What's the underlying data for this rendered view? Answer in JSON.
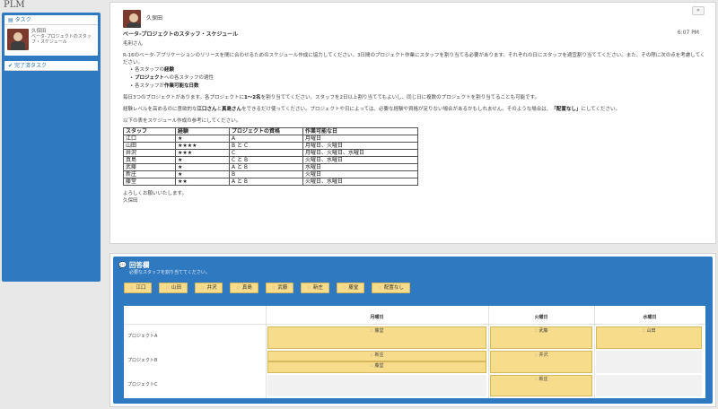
{
  "app": {
    "title": "PLM"
  },
  "sidebar": {
    "tasks_header": "タスク",
    "task": {
      "sender": "久保田",
      "subject": "ベータ-プロジェクトのスタッフ・スケジュール"
    },
    "done_header": "完了済タスク"
  },
  "message": {
    "sender": "久保田",
    "close_label": "«",
    "subject": "ベータ-プロジェクトのスタッフ・スケジュール",
    "time": "6:07 PM",
    "greeting": "毛利さん",
    "para1": "R-16のベータ-アプリケーションのリリースを間に合わせるためのスケジュール作成に協力してください。3日間のプロジェクト作業にスタッフを割り当てる必要があります。それぞれの日にスタッフを適宜割り当ててください。また、その際に次の点を考慮してください。",
    "bullets": [
      {
        "prefix": "各スタッフの",
        "bold": "経験"
      },
      {
        "prefix": "",
        "bold": "プロジェクト",
        "suffix": "への各スタッフの適性"
      },
      {
        "prefix": "各スタッフが",
        "bold": "作業可能な日数"
      }
    ],
    "para2_pre": "毎日3つのプロジェクトがあります。各プロジェクトに",
    "para2_bold": "1～2名",
    "para2_post": "を割り当ててください。スタッフを2日以上割り当ててもよいし、同じ日に複数のプロジェクトを割り当てることも可能です。",
    "para3_pre": "経験レベルを高めるのに意欲的な",
    "para3_bold1": "江口さん",
    "para3_mid": "と",
    "para3_bold2": "真島さん",
    "para3_post": "をできるだけ使ってください。プロジェクトや日によっては、必要な経験や資格が足りない場合があるかもしれません。そのような場合は、",
    "para3_bold3": "「配置なし」",
    "para3_end": "にしてください。",
    "para4": "以下の表をスケジュール作成の参考にしてください。",
    "table": {
      "headers": [
        "スタッフ",
        "経験",
        "プロジェクトの資格",
        "作業可能な日"
      ],
      "rows": [
        [
          "江口",
          "★",
          "A",
          "月曜日"
        ],
        [
          "山田",
          "★★★★",
          "B と C",
          "月曜日、火曜日"
        ],
        [
          "井沢",
          "★★★",
          "C",
          "月曜日、火曜日、水曜日"
        ],
        [
          "真島",
          "★",
          "C と B",
          "火曜日、水曜日"
        ],
        [
          "武藤",
          "★",
          "A と B",
          "水曜日"
        ],
        [
          "新庄",
          "★",
          "B",
          "火曜日"
        ],
        [
          "藤堂",
          "★★",
          "A と B",
          "火曜日、水曜日"
        ]
      ]
    },
    "closing": "よろしくお願いいたします。",
    "signature": "久保田"
  },
  "answer": {
    "title": "回答欄",
    "subtitle": "必要なスタッフを割り当ててください。",
    "chips": [
      "江口",
      "山田",
      "井沢",
      "真島",
      "武藤",
      "新庄",
      "藤堂",
      "配置なし"
    ],
    "grip": "::",
    "days": [
      "月曜日",
      "火曜日",
      "水曜日"
    ],
    "projects": [
      "プロジェクトA",
      "プロジェクトB",
      "プロジェクトC"
    ],
    "assignments": {
      "a_mon": "藤堂",
      "a_tue": "武藤",
      "a_wed": "山田",
      "b_mon_1": "新庄",
      "b_mon_2": "藤堂",
      "b_tue": "井沢",
      "c_tue": "新庄"
    }
  }
}
